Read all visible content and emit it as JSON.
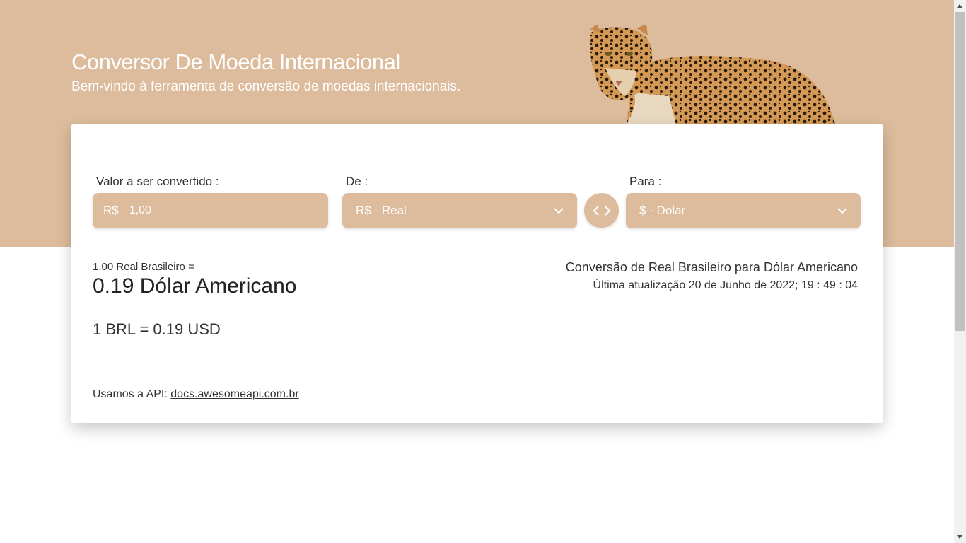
{
  "header": {
    "title": "Conversor De Moeda Internacional",
    "subtitle": "Bem-vindo à ferramenta de conversão de moedas internacionais.",
    "image_icon": "leopard-image"
  },
  "form": {
    "amount_label": "Valor a ser convertido :",
    "amount_prefix": "R$",
    "amount_value": "1,00",
    "from_label": "De :",
    "from_value": "R$ - Real",
    "to_label": "Para :",
    "to_value": "$ - Dolar",
    "swap_icon": "swap-arrows-icon"
  },
  "result": {
    "source_line": "1.00 Real Brasileiro =",
    "converted_line": "0.19 Dólar Americano",
    "rate_line": "1 BRL = 0.19 USD",
    "conversion_title": "Conversão de Real Brasileiro para Dólar Americano",
    "updated_line": "Última atualização 20 de Junho de 2022; 19 : 49 : 04"
  },
  "footer": {
    "api_prefix": "Usamos a API: ",
    "api_link": "docs.awesomeapi.com.br"
  },
  "colors": {
    "accent": "#dcbc9c",
    "text": "#333333",
    "background": "#ffffff"
  }
}
